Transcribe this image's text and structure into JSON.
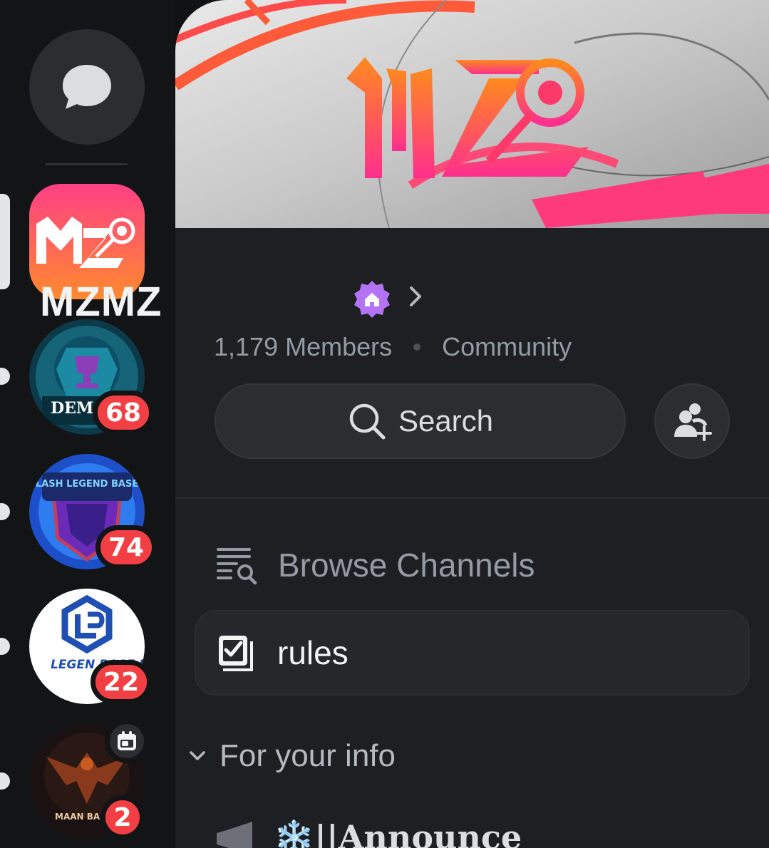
{
  "server_rail": {
    "dm_icon": "chat-bubble-icon",
    "servers": [
      {
        "name": "MZMZ",
        "active": true
      },
      {
        "label_text": "DEMO BAS",
        "badge": "68"
      },
      {
        "label_text": "CLASH LEGEND BASES",
        "badge": "74"
      },
      {
        "label_text": "LEGEN BASE BU",
        "badge": "22"
      },
      {
        "label_text": "MAAN BA",
        "badge": "2",
        "event_icon": "calendar-icon"
      }
    ]
  },
  "server": {
    "name": "MZMZ",
    "boost_icon": "home-badge-icon",
    "members": "1,179 Members",
    "type": "Community"
  },
  "actions": {
    "search_label": "Search",
    "invite_icon": "add-member-icon"
  },
  "channels": {
    "browse_label": "Browse Channels",
    "rules_label": "rules",
    "category_label": "For your info",
    "announce_label": "❄️||Announce"
  },
  "colors": {
    "accent_orange": "#ff7a2a",
    "accent_pink": "#ff3d8b",
    "badge_red": "#f23f43",
    "boost_purple": "#b473f5"
  }
}
